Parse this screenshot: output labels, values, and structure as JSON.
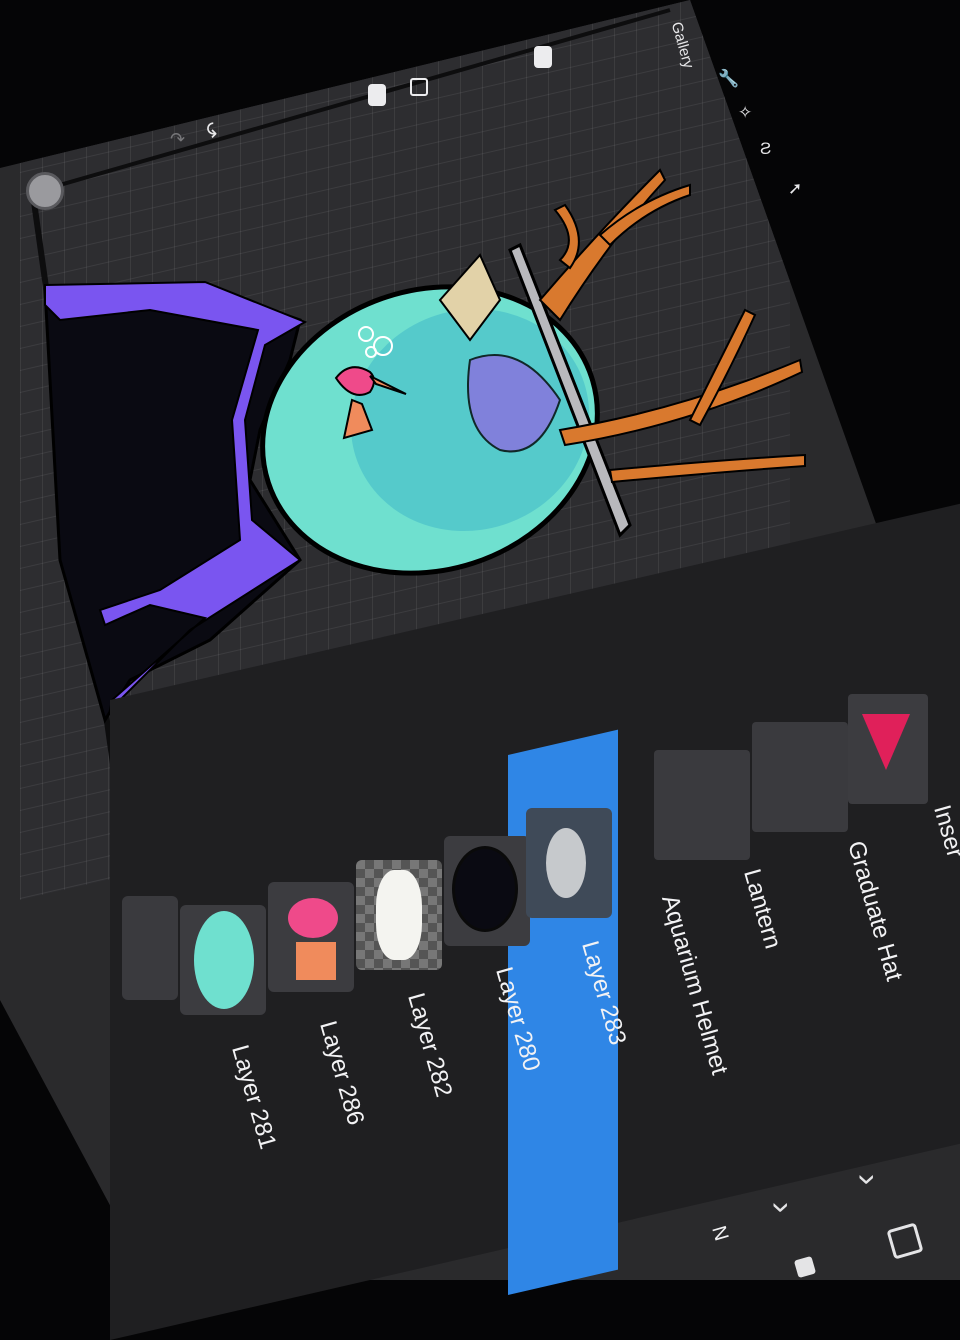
{
  "toolbar": {
    "gallery_label": "Gallery",
    "undo_glyph": "↶",
    "redo_glyph": "↷",
    "icons": [
      "wrench-icon",
      "magic-wand-icon",
      "selection-icon",
      "move-arrow-icon",
      "undo-icon",
      "redo-icon"
    ]
  },
  "layers": [
    {
      "label": "Layer 281",
      "thumb": "teal-helmet-glass"
    },
    {
      "label": "Layer 286",
      "thumb": "pink-fish"
    },
    {
      "label": "Layer 282",
      "thumb": "white-shape-on-transparency"
    },
    {
      "label": "Layer 280",
      "thumb": "helmet-outline"
    },
    {
      "label": "Layer 283",
      "thumb": "bubble-glow",
      "selected": true,
      "blend": "N"
    }
  ],
  "groups": [
    {
      "label": "Aquarium Helmet",
      "chevron": "›"
    },
    {
      "label": "Lantern",
      "chevron": "›"
    },
    {
      "label": "Graduate Hat",
      "chevron": "›"
    },
    {
      "label": "Inser",
      "chevron": ""
    }
  ],
  "colors": {
    "selected_layer": "#2f86e6",
    "robe_purple": "#7a55f0",
    "helmet_teal": "#6fe0cf",
    "antler_orange": "#d9792e",
    "fish_pink": "#ef4a8a"
  }
}
